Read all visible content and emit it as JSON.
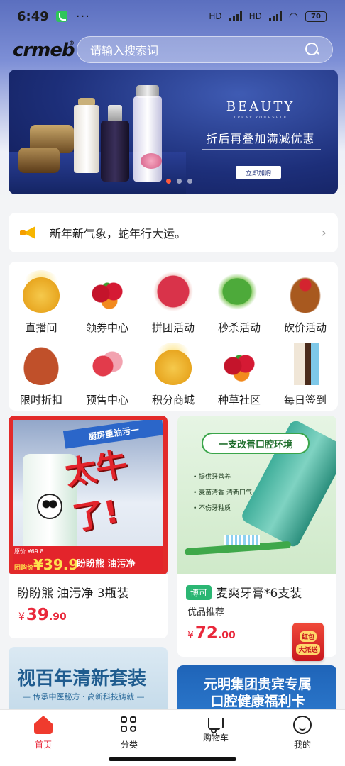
{
  "status_bar": {
    "time": "6:49",
    "battery": "70",
    "network_1": "HD",
    "network_2": "HD"
  },
  "header": {
    "logo_text": "crmeb",
    "search_placeholder": "请输入搜索词"
  },
  "banner": {
    "brand": "BEAUTY",
    "brand_tagline": "TREAT YOURSELF",
    "promo_text": "折后再叠加满减优惠",
    "button_label": "立即加购",
    "slide_count": 3,
    "active_slide": 1
  },
  "notice": {
    "text": "新年新气象，蛇年行大运。"
  },
  "categories": [
    {
      "label": "直播间",
      "icon": "cake-icon"
    },
    {
      "label": "领券中心",
      "icon": "cherry-icon"
    },
    {
      "label": "拼团活动",
      "icon": "meat-icon"
    },
    {
      "label": "秒杀活动",
      "icon": "vegetable-icon"
    },
    {
      "label": "砍价活动",
      "icon": "chicken-icon"
    },
    {
      "label": "限时折扣",
      "icon": "hotpot-icon"
    },
    {
      "label": "预售中心",
      "icon": "berry-icon"
    },
    {
      "label": "积分商城",
      "icon": "cake-icon"
    },
    {
      "label": "种草社区",
      "icon": "cherry-icon"
    },
    {
      "label": "每日签到",
      "icon": "icecream-icon"
    }
  ],
  "products": [
    {
      "title": "盼盼熊 油污净 3瓶装",
      "price_symbol": "¥",
      "price_int": "39",
      "price_dec": ".90",
      "art": {
        "headline": "厨房重油污一",
        "big_text": "太牛了!",
        "old_price": "原价 ¥69.8",
        "promo_price": "¥39.9",
        "promo_prefix": "团购价",
        "brand_label": "盼盼熊 油污净"
      }
    },
    {
      "tag": "博可",
      "title": "麦爽牙膏*6支装",
      "subtitle": "优品推荐",
      "price_symbol": "¥",
      "price_int": "72",
      "price_dec": ".00",
      "art": {
        "headline": "一支改善口腔环境",
        "bullets": [
          "提供牙营养",
          "麦苗清香 清新口气",
          "不伤牙釉质"
        ]
      }
    },
    {
      "art": {
        "title": "视百年清新套装",
        "subtitle": "— 传承中医秘方 · 高新科技铸就 —"
      }
    },
    {
      "art": {
        "line1": "元明集团贵宾专属",
        "line2": "口腔健康福利卡"
      }
    }
  ],
  "floating_envelope": {
    "line1": "红包",
    "line2": "大派送"
  },
  "tabbar": [
    {
      "label": "首页",
      "icon": "home-icon",
      "active": true
    },
    {
      "label": "分类",
      "icon": "category-icon",
      "active": false
    },
    {
      "label": "购物车",
      "icon": "cart-icon",
      "active": false
    },
    {
      "label": "我的",
      "icon": "profile-icon",
      "active": false
    }
  ],
  "colors": {
    "accent": "#e9283b",
    "tab_active": "#ef3b2e",
    "tag_green": "#2bb673"
  }
}
